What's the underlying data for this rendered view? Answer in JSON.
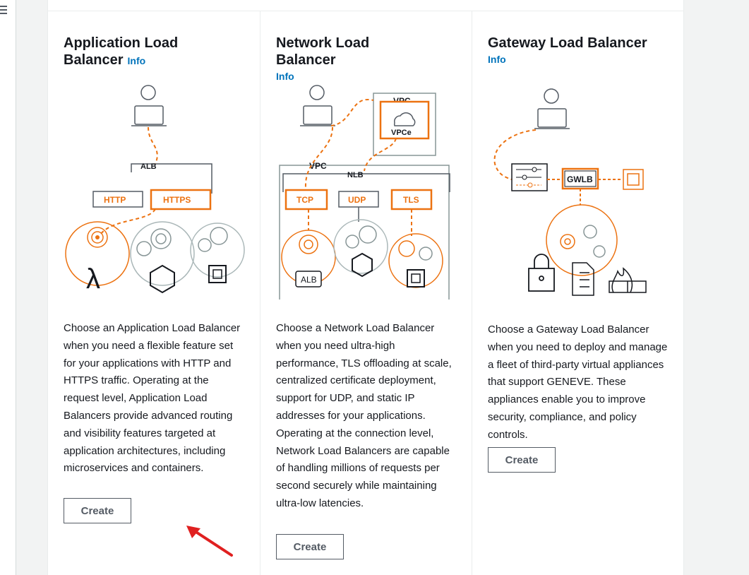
{
  "cards": [
    {
      "title": "Application Load Balancer",
      "info": "Info",
      "diagram": {
        "group": "ALB",
        "protocols": [
          "HTTP",
          "HTTPS"
        ]
      },
      "description": "Choose an Application Load Balancer when you need a flexible feature set for your applications with HTTP and HTTPS traffic. Operating at the request level, Application Load Balancers provide advanced routing and visibility features targeted at application architectures, including microservices and containers.",
      "button": "Create"
    },
    {
      "title": "Network Load Balancer",
      "info": "Info",
      "diagram": {
        "outer": "VPC",
        "inner_vpc": "VPC",
        "endpoint": "VPCe",
        "group": "NLB",
        "protocols": [
          "TCP",
          "UDP",
          "TLS"
        ],
        "target": "ALB"
      },
      "description": "Choose a Network Load Balancer when you need ultra-high performance, TLS offloading at scale, centralized certificate deployment, support for UDP, and static IP addresses for your applications. Operating at the connection level, Network Load Balancers are capable of handling millions of requests per second securely while maintaining ultra-low latencies.",
      "button": "Create"
    },
    {
      "title": "Gateway Load Balancer",
      "info": "Info",
      "diagram": {
        "group": "GWLB"
      },
      "description": "Choose a Gateway Load Balancer when you need to deploy and manage a fleet of third-party virtual appliances that support GENEVE. These appliances enable you to improve security, compliance, and policy controls.",
      "button": "Create"
    }
  ],
  "colors": {
    "accent": "#ec7211",
    "link": "#0073bb",
    "annotation_arrow": "#e02020"
  }
}
